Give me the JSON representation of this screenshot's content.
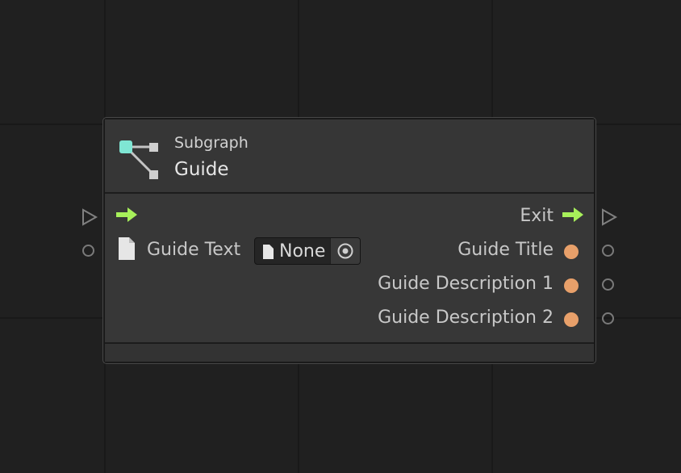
{
  "node": {
    "subtitle": "Subgraph",
    "title": "Guide"
  },
  "inputs": {
    "guide_text_label": "Guide Text",
    "guide_text_value": "None"
  },
  "outputs": {
    "exit_label": "Exit",
    "items": [
      {
        "label": "Guide Title"
      },
      {
        "label": "Guide Description 1"
      },
      {
        "label": "Guide Description 2"
      }
    ]
  },
  "colors": {
    "flow_arrow": "#a7f05a",
    "data_port": "#e8a06a",
    "icon_accent": "#7fe6d4"
  },
  "icons": {
    "node_icon": "subgraph-icon",
    "flow_in": "arrow-right-icon",
    "flow_out": "arrow-right-icon",
    "text_asset": "file-icon",
    "picker": "target-icon",
    "external_flow": "triangle-outline-icon",
    "external_data": "circle-outline-icon"
  }
}
